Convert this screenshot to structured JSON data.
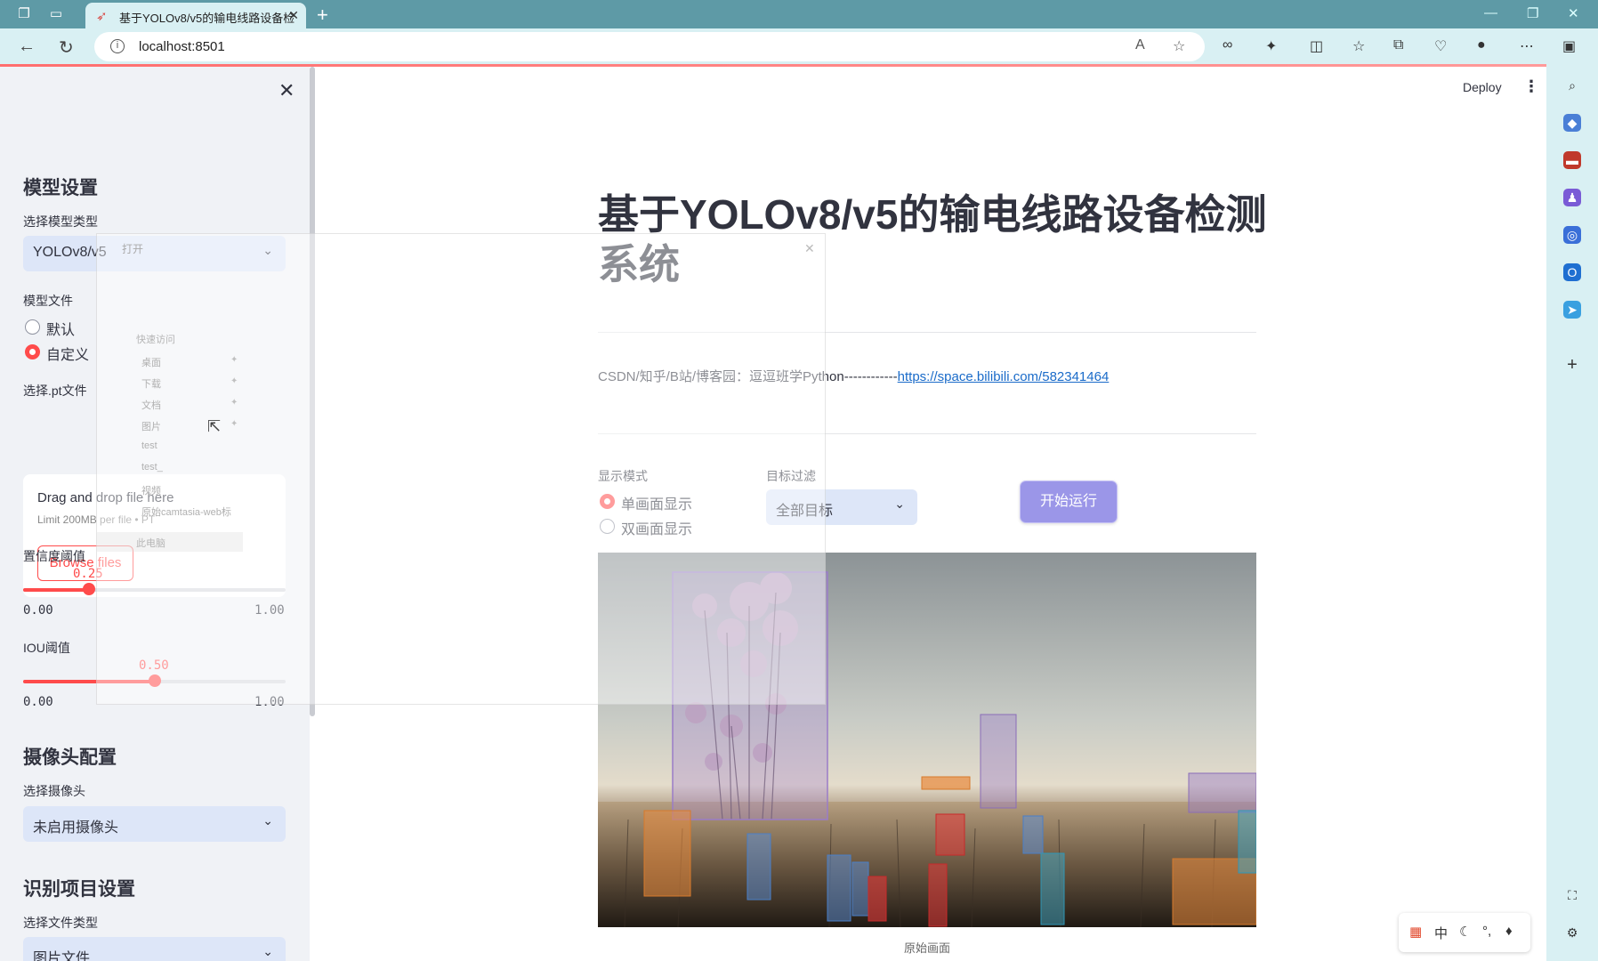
{
  "browser": {
    "tab_title": "基于YOLOv8/v5的输电线路设备检",
    "url": "localhost:8501"
  },
  "sidebar": {
    "model_settings": {
      "heading": "模型设置",
      "model_type_label": "选择模型类型",
      "model_type_value": "YOLOv8/v5",
      "model_file_label": "模型文件",
      "options": [
        "默认",
        "自定义"
      ],
      "selected": "自定义",
      "pt_label": "选择.pt文件",
      "upload_drag": "Drag and drop file here",
      "upload_limit": "Limit 200MB per file • PT",
      "upload_button": "Browse files",
      "conf_label": "置信度阈值",
      "conf_value": "0.25",
      "conf_min": "0.00",
      "conf_max": "1.00",
      "iou_label": "IOU阈值",
      "iou_value": "0.50",
      "iou_min": "0.00",
      "iou_max": "1.00"
    },
    "camera": {
      "heading": "摄像头配置",
      "label": "选择摄像头",
      "value": "未启用摄像头"
    },
    "recognition": {
      "heading": "识别项目设置",
      "label": "选择文件类型",
      "value": "图片文件"
    }
  },
  "main": {
    "deploy": "Deploy",
    "title": "基于YOLOv8/v5的输电线路设备检测系统",
    "credit_text": "CSDN/知乎/B站/博客园：逗逗班学Python------------",
    "credit_link": "https://space.bilibili.com/582341464",
    "display_mode_label": "显示模式",
    "display_options": [
      "单画面显示",
      "双画面显示"
    ],
    "display_selected": "单画面显示",
    "filter_label": "目标过滤",
    "filter_value": "全部目标",
    "run_button": "开始运行",
    "image_caption": "原始画面"
  },
  "dialog": {
    "title": "打开",
    "quick_access": "快速访问",
    "items": [
      "桌面",
      "下载",
      "文档",
      "图片",
      "test",
      "test_",
      "视频",
      "原始camtasia-web标"
    ],
    "this_pc": "此电脑"
  },
  "ime": {
    "mode": "中"
  },
  "colors": {
    "accent": "#ff4b4b",
    "run_button": "#9b96e8",
    "select_bg": "#dde6f8",
    "sidebar_bg": "#f0f2f6",
    "chrome_teal": "#5e9aa6"
  }
}
